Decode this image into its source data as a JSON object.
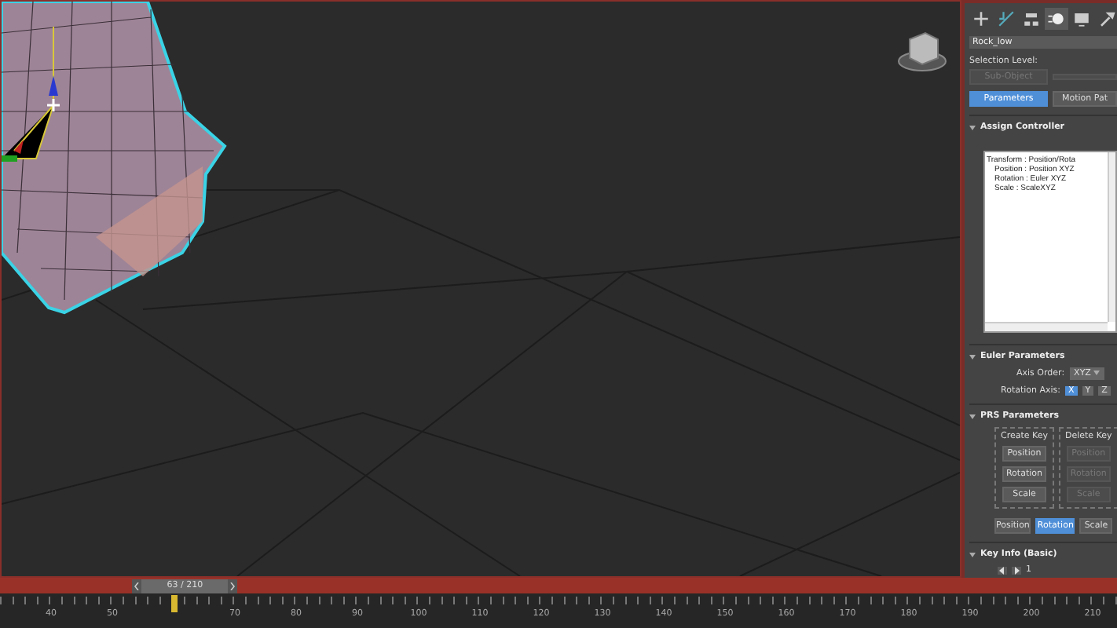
{
  "command_panel": {
    "tabs": [
      {
        "kind": "create",
        "selected": false
      },
      {
        "kind": "modify",
        "selected": false
      },
      {
        "kind": "hierarchy",
        "selected": false
      },
      {
        "kind": "motion",
        "selected": true
      },
      {
        "kind": "display",
        "selected": false
      },
      {
        "kind": "utilities",
        "selected": false
      }
    ],
    "object_name": "Rock_low",
    "selection_level": {
      "label": "Selection Level:",
      "buttons": [
        {
          "label": "Sub-Object",
          "disabled": true
        }
      ]
    },
    "mode_tabs": [
      {
        "label": "Parameters",
        "selected": true
      },
      {
        "label": "Motion Pat",
        "selected": false
      }
    ],
    "assign_controller": {
      "title": "Assign Controller",
      "tree": [
        {
          "label": "Transform : Position/Rota",
          "children": [
            {
              "label": "Position : Position XYZ"
            },
            {
              "label": "Rotation : Euler XYZ"
            },
            {
              "label": "Scale : ScaleXYZ"
            }
          ]
        }
      ]
    },
    "euler_parameters": {
      "title": "Euler Parameters",
      "axis_order_label": "Axis Order:",
      "axis_order": "XYZ",
      "rotation_axis_label": "Rotation Axis:",
      "axes": [
        {
          "label": "X",
          "selected": true
        },
        {
          "label": "Y",
          "selected": false
        },
        {
          "label": "Z",
          "selected": false
        }
      ]
    },
    "prs_parameters": {
      "title": "PRS Parameters",
      "create_key": {
        "title": "Create Key",
        "buttons": [
          {
            "label": "Position",
            "disabled": false
          },
          {
            "label": "Rotation",
            "disabled": false
          },
          {
            "label": "Scale",
            "disabled": false
          }
        ]
      },
      "delete_key": {
        "title": "Delete Key",
        "buttons": [
          {
            "label": "Position",
            "disabled": true
          },
          {
            "label": "Rotation",
            "disabled": true
          },
          {
            "label": "Scale",
            "disabled": true
          }
        ]
      },
      "modes": [
        {
          "label": "Position",
          "selected": false
        },
        {
          "label": "Rotation",
          "selected": true
        },
        {
          "label": "Scale",
          "selected": false
        }
      ]
    },
    "key_info": {
      "title": "Key Info (Basic)",
      "key_number": "1"
    }
  },
  "timeline": {
    "slider": "63 / 210",
    "level": 0.13,
    "ruler": [
      {
        "kind": "label",
        "text": "40"
      },
      {
        "kind": "label",
        "text": "50"
      },
      {
        "kind": "cursor"
      },
      {
        "kind": "label",
        "text": "70"
      },
      {
        "kind": "label",
        "text": "80"
      },
      {
        "kind": "label",
        "text": "90"
      },
      {
        "kind": "label",
        "text": "100"
      },
      {
        "kind": "label",
        "text": "110"
      },
      {
        "kind": "label",
        "text": "120"
      },
      {
        "kind": "label",
        "text": "130"
      },
      {
        "kind": "label",
        "text": "140"
      },
      {
        "kind": "label",
        "text": "150"
      },
      {
        "kind": "label",
        "text": "160"
      },
      {
        "kind": "label",
        "text": "170"
      },
      {
        "kind": "label",
        "text": "180"
      },
      {
        "kind": "label",
        "text": "190"
      },
      {
        "kind": "label",
        "text": "200"
      },
      {
        "kind": "label",
        "text": "210"
      }
    ]
  }
}
